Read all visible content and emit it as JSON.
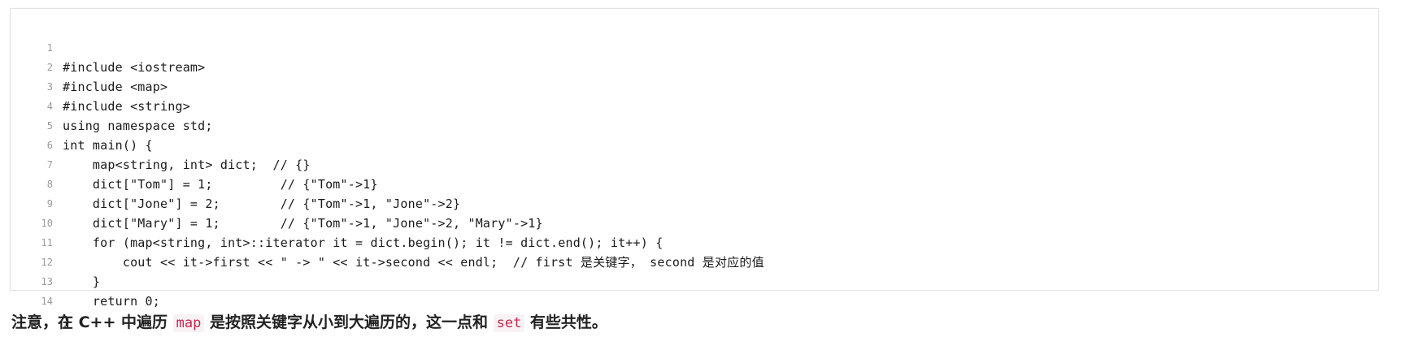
{
  "code": {
    "lines": [
      {
        "no": "1",
        "text": "#include <iostream>"
      },
      {
        "no": "2",
        "text": "#include <map>"
      },
      {
        "no": "3",
        "text": "#include <string>"
      },
      {
        "no": "4",
        "text": "using namespace std;"
      },
      {
        "no": "5",
        "text": "int main() {"
      },
      {
        "no": "6",
        "text": "    map<string, int> dict;  // {}"
      },
      {
        "no": "7",
        "text": "    dict[\"Tom\"] = 1;         // {\"Tom\"->1}"
      },
      {
        "no": "8",
        "text": "    dict[\"Jone\"] = 2;        // {\"Tom\"->1, \"Jone\"->2}"
      },
      {
        "no": "9",
        "text": "    dict[\"Mary\"] = 1;        // {\"Tom\"->1, \"Jone\"->2, \"Mary\"->1}"
      },
      {
        "no": "10",
        "text": "    for (map<string, int>::iterator it = dict.begin(); it != dict.end(); it++) {"
      },
      {
        "no": "11",
        "text": "        cout << it->first << \" -> \" << it->second << endl;  // first 是关键字， second 是对应的值"
      },
      {
        "no": "12",
        "text": "    }"
      },
      {
        "no": "13",
        "text": "    return 0;"
      },
      {
        "no": "14",
        "text": "}"
      }
    ]
  },
  "note": {
    "part1": "注意，在 C++ 中遍历 ",
    "kw1": "map",
    "part2": " 是按照关键字从小到大遍历的，这一点和 ",
    "kw2": "set",
    "part3": " 有些共性。"
  },
  "colors": {
    "inline_code": "#c7254e",
    "inline_code_bg": "#f9f2f4"
  }
}
